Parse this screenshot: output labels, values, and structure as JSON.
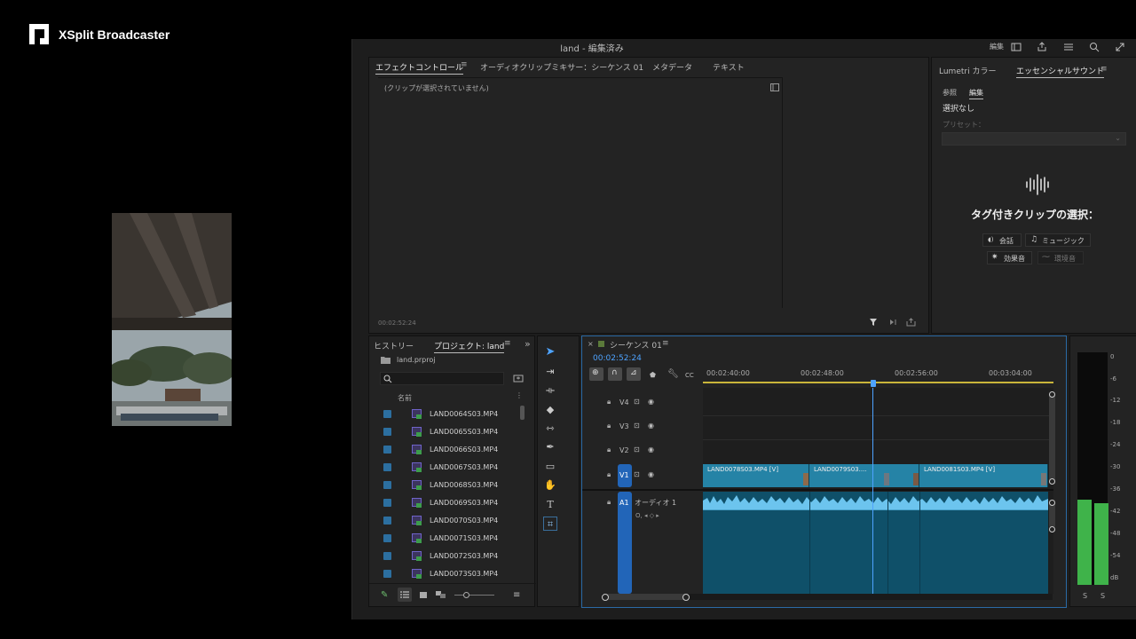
{
  "xsplit": {
    "title": "XSplit Broadcaster"
  },
  "premiere": {
    "window_title": "land - 編集済み",
    "edit_label": "編集",
    "effects_panel": {
      "tabs": [
        "エフェクトコントロール",
        "オーディオクリップミキサー：シーケンス 01",
        "メタデータ",
        "テキスト"
      ],
      "empty_message": "(クリップが選択されていません)",
      "timecode": "00:02:52:24"
    },
    "essential_sound": {
      "tabs": [
        "Lumetri カラー",
        "エッセンシャルサウンド"
      ],
      "subtabs": [
        "参照",
        "編集"
      ],
      "selection": "選択なし",
      "preset_label": "プリセット：",
      "heading": "タグ付きクリップの選択：",
      "buttons": [
        "会話",
        "ミュージック",
        "効果音",
        "環境音"
      ]
    },
    "project_panel": {
      "tabs": [
        "ヒストリー",
        "プロジェクト: land"
      ],
      "project_file": "land.prproj",
      "column_name": "名前",
      "items": [
        "LAND0064S03.MP4",
        "LAND0065S03.MP4",
        "LAND0066S03.MP4",
        "LAND0067S03.MP4",
        "LAND0068S03.MP4",
        "LAND0069S03.MP4",
        "LAND0070S03.MP4",
        "LAND0071S03.MP4",
        "LAND0072S03.MP4",
        "LAND0073S03.MP4"
      ]
    },
    "timeline": {
      "sequence_name": "シーケンス 01",
      "timecode": "00:02:52:24",
      "ruler": [
        "00:02:40:00",
        "00:02:48:00",
        "00:02:56:00",
        "00:03:04:00"
      ],
      "tracks_video": [
        "V4",
        "V3",
        "V2",
        "V1"
      ],
      "track_audio": "A1",
      "audio_name": "オーディオ 1",
      "clips": [
        "LAND0078S03.MP4 [V]",
        "LAND0079S03....",
        "LAND0081S03.MP4 [V]"
      ]
    },
    "audio_meter": {
      "ticks": [
        "0",
        "-6",
        "-12",
        "-18",
        "-24",
        "-30",
        "-36",
        "-42",
        "-48",
        "-54",
        "dB"
      ],
      "channels": [
        "S",
        "S"
      ],
      "levels_db": [
        -38,
        -39
      ]
    }
  }
}
